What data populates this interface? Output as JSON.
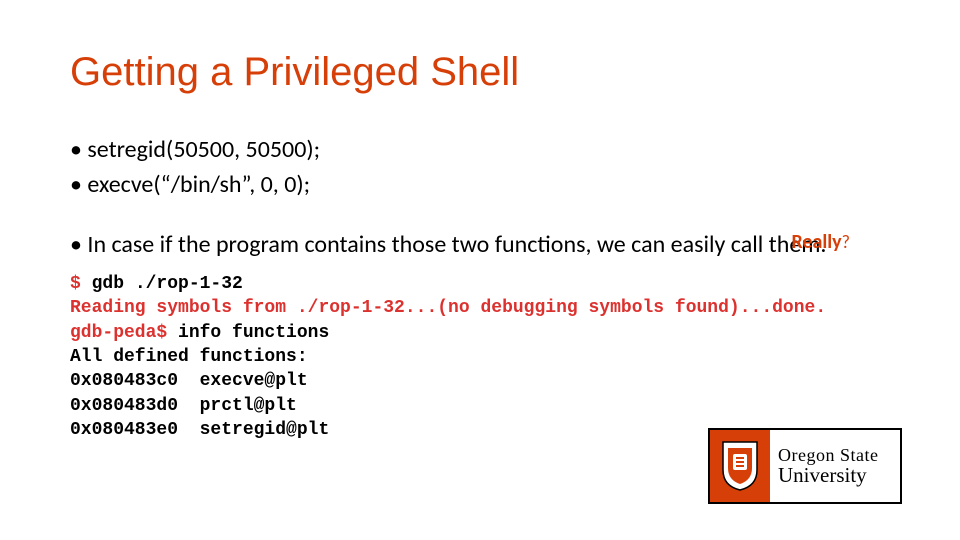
{
  "title": "Getting a Privileged Shell",
  "bullets": [
    "setregid(50500, 50500);",
    "execve(“/bin/sh”, 0, 0);"
  ],
  "annotation": {
    "text": "Really",
    "suffix": "?"
  },
  "body": "In case if the program contains those two functions, we can easily call them.",
  "terminal": {
    "prompt1": "$",
    "cmd1": " gdb ./rop-1-32",
    "line2": "Reading symbols from ./rop-1-32...(no debugging symbols found)...done.",
    "prompt2": "gdb-peda$",
    "cmd2": " info functions",
    "line4": "All defined functions:",
    "line5": "0x080483c0  execve@plt",
    "line6": "0x080483d0  prctl@plt",
    "line7": "0x080483e0  setregid@plt"
  },
  "logo": {
    "line1": "Oregon State",
    "line2": "University"
  }
}
